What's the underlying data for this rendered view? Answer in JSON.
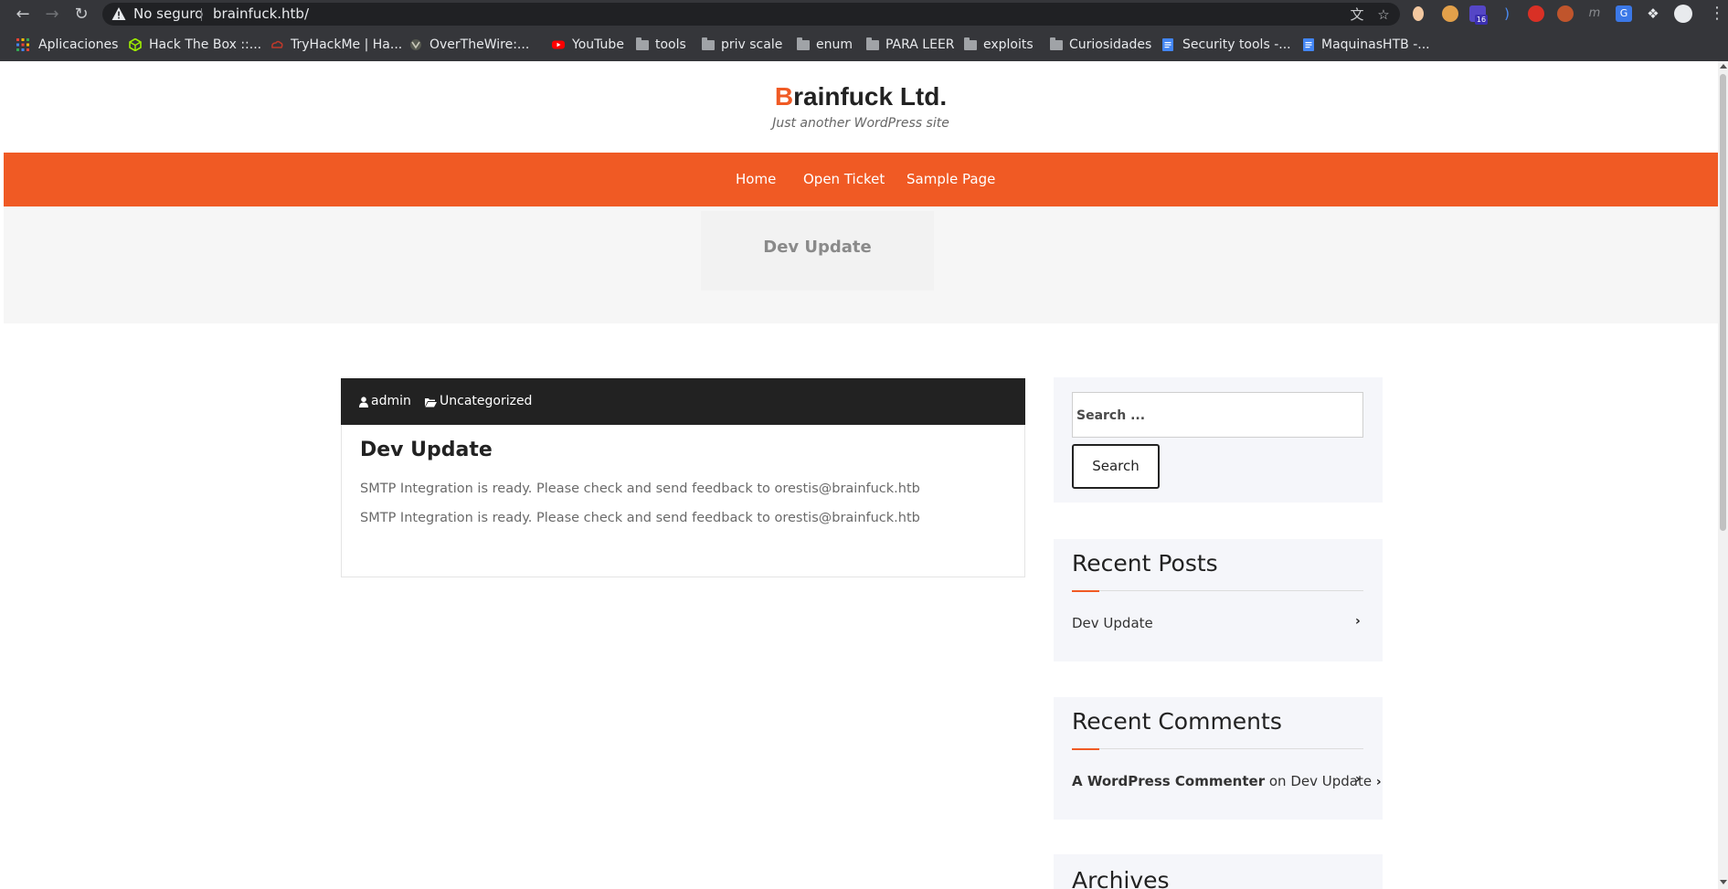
{
  "browser": {
    "security_label": "No seguro",
    "url": "brainfuck.htb/",
    "extension_badge": "16",
    "bookmarks": [
      {
        "label": "Aplicaciones",
        "icon": "apps-grid-icon"
      },
      {
        "label": "Hack The Box ::...",
        "icon": "htb-cube-icon"
      },
      {
        "label": "TryHackMe | Ha...",
        "icon": "tryhackme-icon"
      },
      {
        "label": "OverTheWire:...",
        "icon": "overthewire-icon"
      },
      {
        "label": "YouTube",
        "icon": "youtube-icon"
      },
      {
        "label": "tools",
        "icon": "folder-icon"
      },
      {
        "label": "priv scale",
        "icon": "folder-icon"
      },
      {
        "label": "enum",
        "icon": "folder-icon"
      },
      {
        "label": "PARA LEER",
        "icon": "folder-icon"
      },
      {
        "label": "exploits",
        "icon": "folder-icon"
      },
      {
        "label": "Curiosidades",
        "icon": "folder-icon"
      },
      {
        "label": "Security tools -...",
        "icon": "google-doc-icon"
      },
      {
        "label": "MaquinasHTB -...",
        "icon": "google-doc-icon"
      }
    ]
  },
  "site": {
    "title_first": "B",
    "title_rest": "rainfuck Ltd.",
    "tagline": "Just another WordPress site",
    "accent_color": "#f05a24",
    "nav": [
      "Home",
      "Open Ticket",
      "Sample Page"
    ],
    "page_header": "Dev Update"
  },
  "post": {
    "author": "admin",
    "category": "Uncategorized",
    "title": "Dev Update",
    "lines": [
      "SMTP Integration is ready. Please check and send feedback to orestis@brainfuck.htb",
      "SMTP Integration is ready. Please check and send feedback to orestis@brainfuck.htb"
    ]
  },
  "sidebar": {
    "search_placeholder": "Search ...",
    "search_button": "Search",
    "recent_posts_title": "Recent Posts",
    "recent_posts": [
      "Dev Update"
    ],
    "recent_comments_title": "Recent Comments",
    "comment_author": "A WordPress Commenter",
    "comment_on": "on",
    "comment_post": "Dev Update",
    "archives_title": "Archives"
  }
}
